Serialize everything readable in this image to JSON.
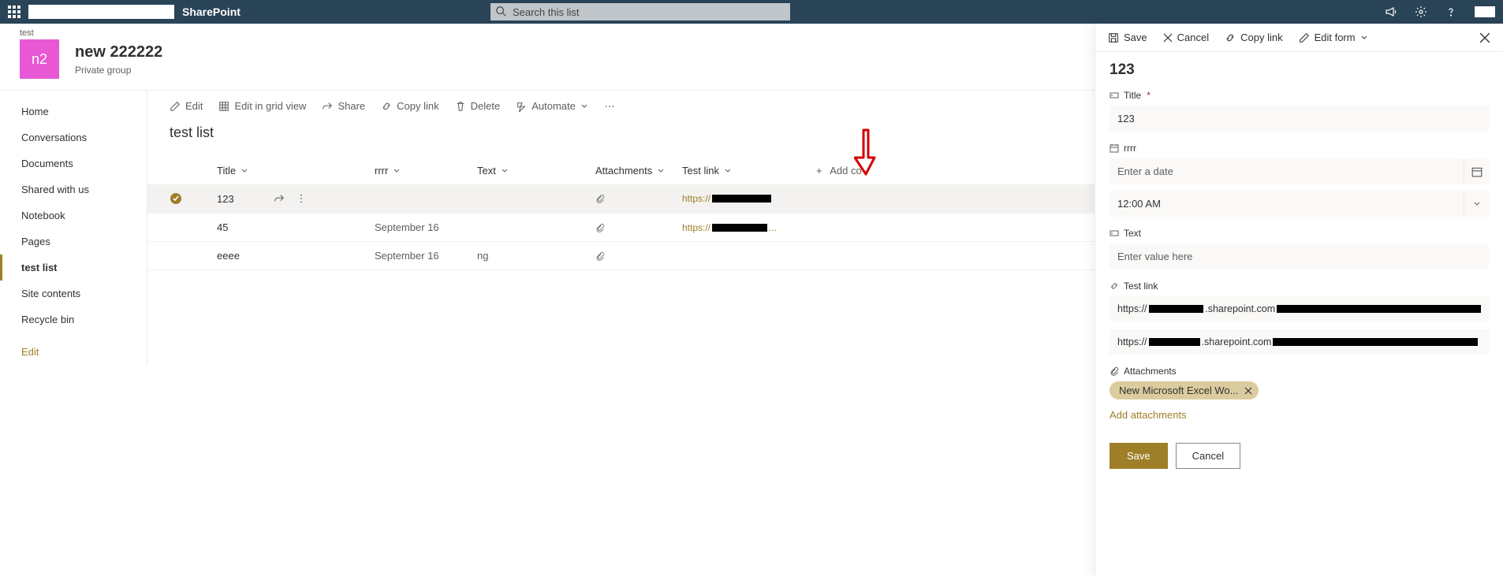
{
  "header": {
    "app_title": "SharePoint",
    "search_placeholder": "Search this list"
  },
  "site": {
    "crumb": "test",
    "tile": "n2",
    "name": "new 222222",
    "sub": "Private group"
  },
  "sidebar": {
    "items": [
      {
        "label": "Home"
      },
      {
        "label": "Conversations"
      },
      {
        "label": "Documents"
      },
      {
        "label": "Shared with us"
      },
      {
        "label": "Notebook"
      },
      {
        "label": "Pages"
      },
      {
        "label": "test list"
      },
      {
        "label": "Site contents"
      },
      {
        "label": "Recycle bin"
      }
    ],
    "edit": "Edit"
  },
  "toolbar": {
    "edit": "Edit",
    "grid": "Edit in grid view",
    "share": "Share",
    "copy": "Copy link",
    "delete": "Delete",
    "automate": "Automate"
  },
  "list": {
    "title": "test list",
    "columns": {
      "title": "Title",
      "rrrr": "rrrr",
      "text": "Text",
      "attachments": "Attachments",
      "testlink": "Test link",
      "add": "Add co"
    },
    "rows": [
      {
        "title": "123",
        "rrrr": "",
        "text": "",
        "link_prefix": "https://"
      },
      {
        "title": "45",
        "rrrr": "September 16",
        "text": "",
        "link_prefix": "https://"
      },
      {
        "title": "eeee",
        "rrrr": "September 16",
        "text": "ng",
        "link_prefix": ""
      }
    ]
  },
  "panel": {
    "cmd": {
      "save": "Save",
      "cancel": "Cancel",
      "copy": "Copy link",
      "edit": "Edit form"
    },
    "heading": "123",
    "fields": {
      "title_label": "Title",
      "title_value": "123",
      "rrrr_label": "rrrr",
      "rrrr_placeholder": "Enter a date",
      "time_value": "12:00 AM",
      "text_label": "Text",
      "text_placeholder": "Enter value here",
      "testlink_label": "Test link",
      "link1_prefix": "https://",
      "link1_mid": ".sharepoint.com",
      "link2_prefix": "https://",
      "link2_mid": ".sharepoint.com",
      "attachments_label": "Attachments",
      "attachment1": "New Microsoft Excel Wo...",
      "add_attachments": "Add attachments"
    },
    "footer": {
      "save": "Save",
      "cancel": "Cancel"
    }
  }
}
